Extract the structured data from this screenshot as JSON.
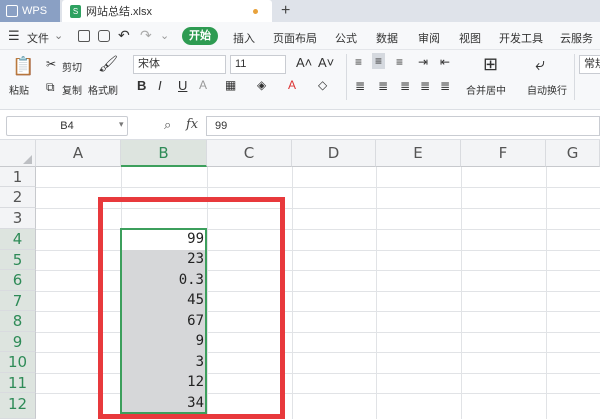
{
  "tabs": {
    "app_label": "WPS",
    "file_name": "网站总结.xlsx",
    "new_tab_glyph": "+"
  },
  "menubar": {
    "file_label": "文件",
    "start_label": "开始",
    "items": [
      "插入",
      "页面布局",
      "公式",
      "数据",
      "审阅",
      "视图",
      "开发工具",
      "云服务"
    ]
  },
  "ribbon": {
    "paste": "粘贴",
    "cut": "剪切",
    "copy": "复制",
    "format_painter": "格式刷",
    "font_name": "宋体",
    "font_size": "11",
    "bold": "B",
    "italic": "I",
    "underline": "U",
    "merge_center": "合并居中",
    "auto_wrap": "自动换行",
    "number_format": "常规"
  },
  "formula_bar": {
    "name_box": "B4",
    "fx": "fx",
    "value": "99"
  },
  "columns": [
    "A",
    "B",
    "C",
    "D",
    "E",
    "F",
    "G"
  ],
  "rows": [
    "1",
    "2",
    "3",
    "4",
    "5",
    "6",
    "7",
    "8",
    "9",
    "10",
    "11",
    "12"
  ],
  "cells_B": [
    "99",
    "23",
    "0.3",
    "45",
    "67",
    "9",
    "3",
    "12",
    "34"
  ],
  "colors": {
    "accent": "#2e9b52",
    "highlight": "#e8393c"
  }
}
